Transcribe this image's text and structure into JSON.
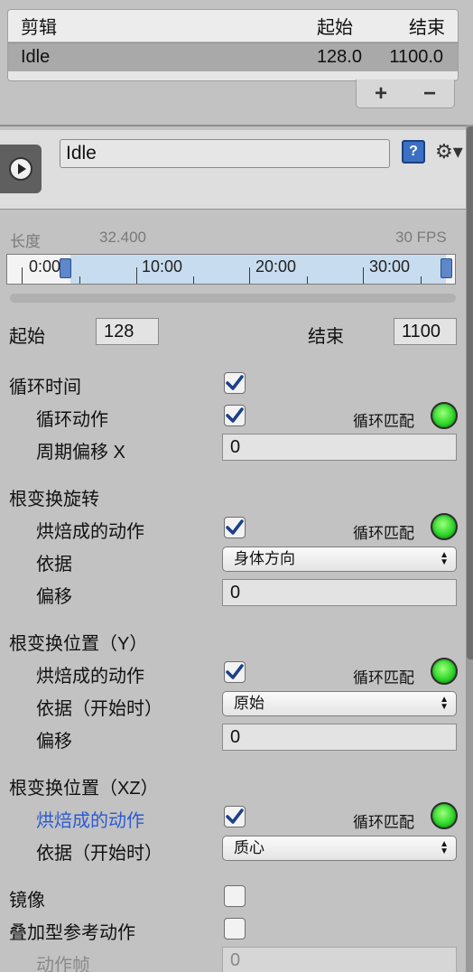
{
  "clips": {
    "header": {
      "name": "剪辑",
      "start": "起始",
      "end": "结束"
    },
    "rows": [
      {
        "name": "Idle",
        "start": "128.0",
        "end": "1100.0"
      }
    ],
    "add_label": "+",
    "remove_label": "−"
  },
  "clip": {
    "name": "Idle",
    "help_icon": "?",
    "gear_icon": "⚙▾"
  },
  "timeline": {
    "length_label": "长度",
    "length_value": "32.400",
    "fps": "30 FPS",
    "ticks": [
      "0:00",
      "10:00",
      "20:00",
      "30:00"
    ]
  },
  "range": {
    "start_label": "起始",
    "start_value": "128",
    "end_label": "结束",
    "end_value": "1100"
  },
  "loop_time": {
    "label": "循环时间",
    "checked": true,
    "loop_pose_label": "循环动作",
    "loop_pose_checked": true,
    "loop_match_label": "循环匹配",
    "cycle_offset_label": "周期偏移 X",
    "cycle_offset_value": "0"
  },
  "root_rotation": {
    "title": "根变换旋转",
    "bake_label": "烘焙成的动作",
    "bake_checked": true,
    "loop_match_label": "循环匹配",
    "based_on_label": "依据",
    "based_on_value": "身体方向",
    "offset_label": "偏移",
    "offset_value": "0"
  },
  "root_position_y": {
    "title": "根变换位置（Y）",
    "bake_label": "烘焙成的动作",
    "bake_checked": true,
    "loop_match_label": "循环匹配",
    "based_on_label": "依据（开始时）",
    "based_on_value": "原始",
    "offset_label": "偏移",
    "offset_value": "0"
  },
  "root_position_xz": {
    "title": "根变换位置（XZ）",
    "bake_label": "烘焙成的动作",
    "bake_checked": true,
    "loop_match_label": "循环匹配",
    "based_on_label": "依据（开始时）",
    "based_on_value": "质心"
  },
  "mirror": {
    "label": "镜像",
    "checked": false
  },
  "additive": {
    "label": "叠加型参考动作",
    "checked": false,
    "frame_label": "动作帧",
    "frame_value": "0"
  },
  "colors": {
    "panel_bg": "#c2c2c2",
    "highlight_label": "#2b5bd3",
    "led_green": "#2fd82a",
    "check_blue": "#1d3f8a"
  }
}
